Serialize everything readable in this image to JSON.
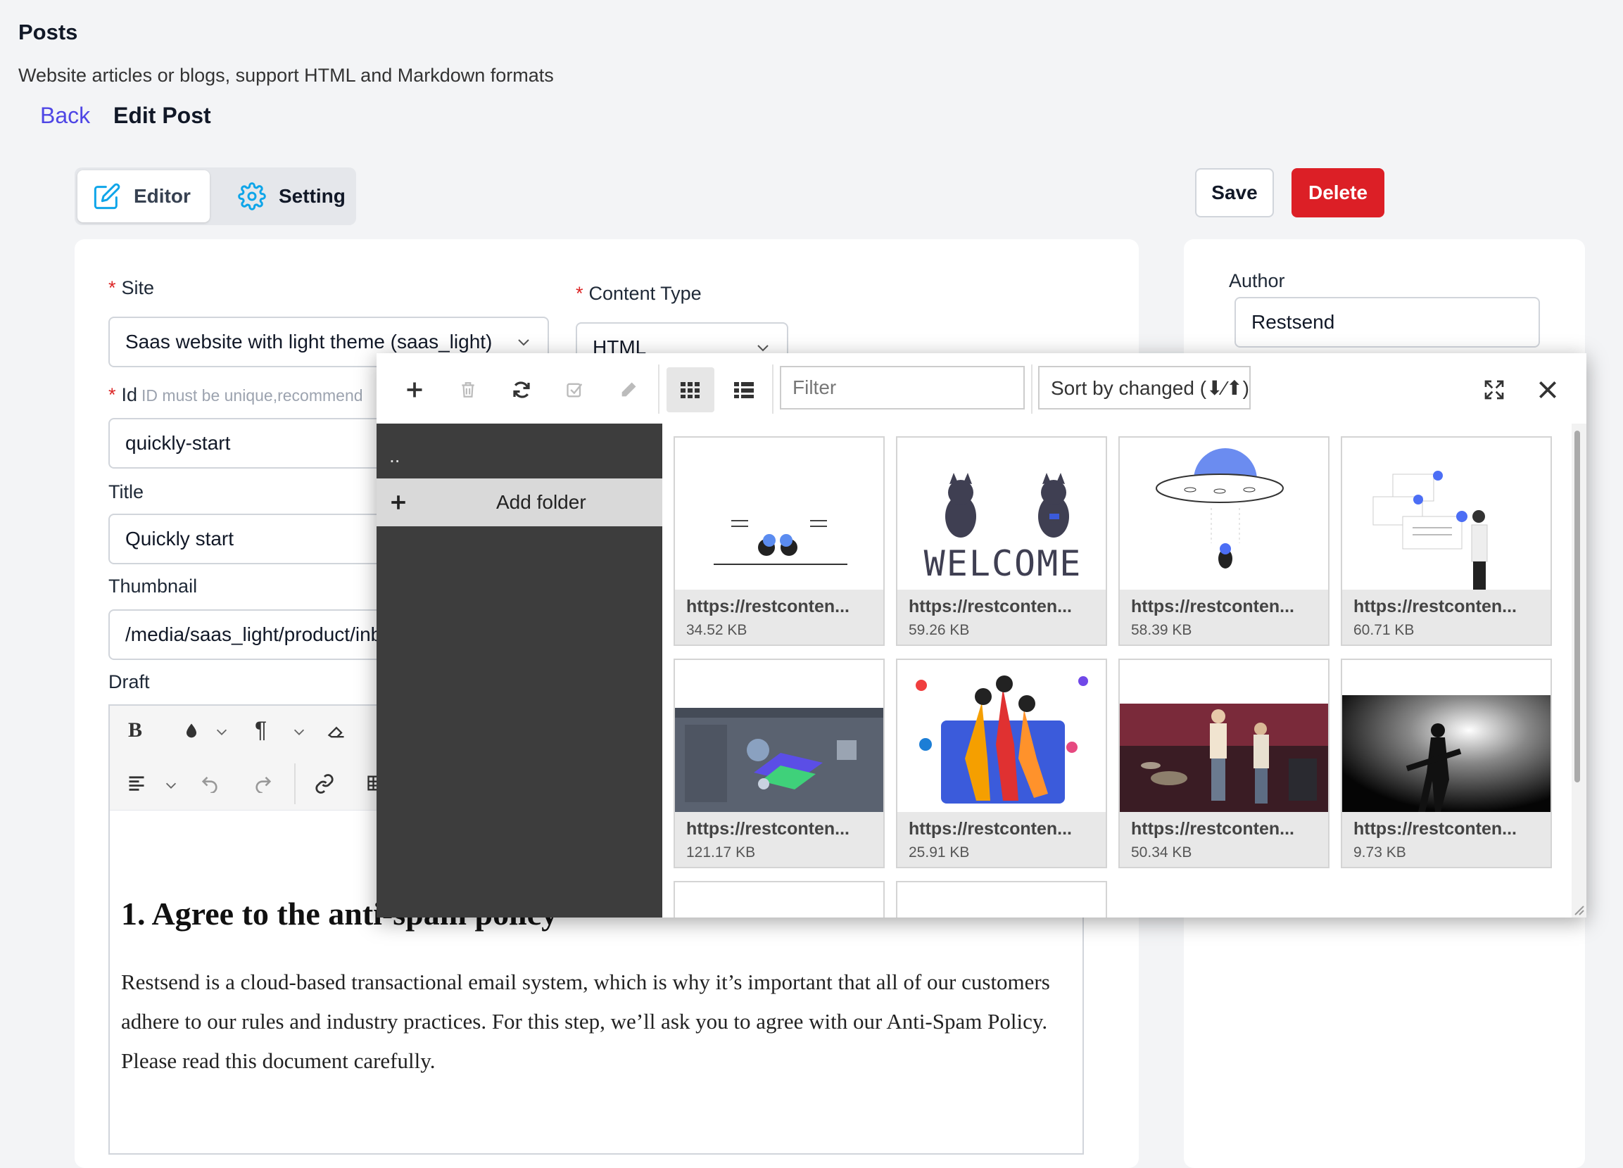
{
  "header": {
    "title": "Posts",
    "subtitle": "Website articles or blogs, support HTML and Markdown formats",
    "back_label": "Back",
    "edit_title": "Edit Post"
  },
  "tabs": [
    {
      "label": "Editor",
      "icon": "pencil-square-icon",
      "active": true
    },
    {
      "label": "Setting",
      "icon": "gear-icon",
      "active": false
    }
  ],
  "actions": {
    "save_label": "Save",
    "delete_label": "Delete"
  },
  "form": {
    "site_label": "Site",
    "site_value": "Saas website with light theme (saas_light)",
    "content_type_label": "Content Type",
    "content_type_value": "HTML",
    "id_label": "Id",
    "id_hint": "ID must be unique,recommend",
    "id_value": "quickly-start",
    "title_label": "Title",
    "title_value": "Quickly start",
    "thumbnail_label": "Thumbnail",
    "thumbnail_value": "/media/saas_light/product/inb",
    "draft_label": "Draft",
    "author_label": "Author",
    "author_value": "Restsend"
  },
  "document": {
    "heading": "1. Agree to the anti-spam policy",
    "paragraph": "Restsend is a cloud-based transactional email system, which is why it’s important that all of our customers adhere to our rules and industry practices. For this step, we’ll ask you to agree with our Anti-Spam Policy. Please read this document carefully."
  },
  "file_manager": {
    "filter_placeholder": "Filter",
    "sort_label": "Sort by changed (⬇⁄⬆)",
    "up_dir": "..",
    "add_folder_label": "Add folder",
    "files": [
      {
        "url": "https://restconten...",
        "size": "34.52 KB"
      },
      {
        "url": "https://restconten...",
        "size": "59.26 KB"
      },
      {
        "url": "https://restconten...",
        "size": "58.39 KB"
      },
      {
        "url": "https://restconten...",
        "size": "60.71 KB"
      },
      {
        "url": "https://restconten...",
        "size": "121.17 KB"
      },
      {
        "url": "https://restconten...",
        "size": "25.91 KB"
      },
      {
        "url": "https://restconten...",
        "size": "50.34 KB"
      },
      {
        "url": "https://restconten...",
        "size": "9.73 KB"
      }
    ],
    "welcome_text": "WELCOME"
  },
  "colors": {
    "accent": "#4f46e5",
    "danger": "#dc1f26",
    "icon_blue": "#0ea5e9"
  }
}
